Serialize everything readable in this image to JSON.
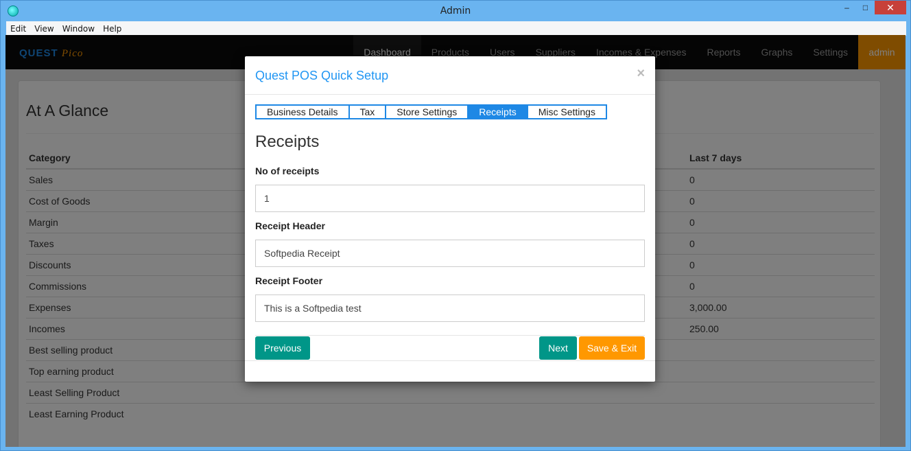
{
  "window": {
    "title": "Admin",
    "min": "–",
    "max": "□",
    "close": "✕"
  },
  "menubar": [
    "Edit",
    "View",
    "Window",
    "Help"
  ],
  "logo": {
    "part1": "QUEST",
    "part2": "Pico"
  },
  "nav": {
    "items": [
      "Dashboard",
      "Products",
      "Users",
      "Suppliers",
      "Incomes & Expenses",
      "Reports",
      "Graphs",
      "Settings"
    ],
    "active": "Dashboard",
    "user": "admin"
  },
  "glance": {
    "title": "At A Glance",
    "columns": [
      "Category",
      "Last 7 days"
    ],
    "rows": [
      [
        "Sales",
        "0"
      ],
      [
        "Cost of Goods",
        "0"
      ],
      [
        "Margin",
        "0"
      ],
      [
        "Taxes",
        "0"
      ],
      [
        "Discounts",
        "0"
      ],
      [
        "Commissions",
        "0"
      ],
      [
        "Expenses",
        "3,000.00"
      ],
      [
        "Incomes",
        "250.00"
      ],
      [
        "Best selling product",
        ""
      ],
      [
        "Top earning product",
        ""
      ],
      [
        "Least Selling Product",
        ""
      ],
      [
        "Least Earning Product",
        ""
      ]
    ]
  },
  "modal": {
    "title": "Quest POS Quick Setup",
    "close": "×",
    "tabs": [
      "Business Details",
      "Tax",
      "Store Settings",
      "Receipts",
      "Misc Settings"
    ],
    "active_tab": "Receipts",
    "section_title": "Receipts",
    "fields": [
      {
        "label": "No of receipts",
        "value": "1"
      },
      {
        "label": "Receipt Header",
        "value": "Softpedia Receipt"
      },
      {
        "label": "Receipt Footer",
        "value": "This is a Softpedia test"
      }
    ],
    "buttons": {
      "previous": "Previous",
      "next": "Next",
      "save_exit": "Save & Exit"
    }
  }
}
